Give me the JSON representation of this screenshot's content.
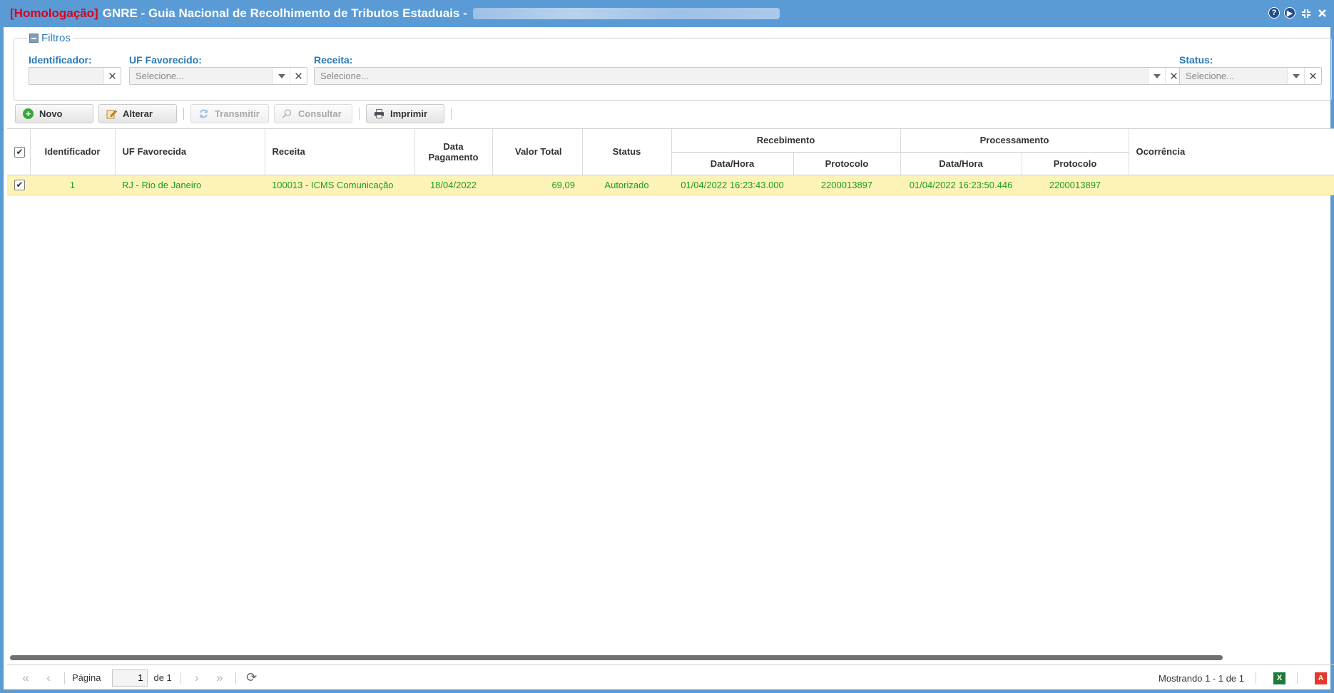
{
  "window": {
    "env_tag": "[Homologação]",
    "title": "GNRE - Guia Nacional de Recolhimento de Tributos Estaduais -",
    "tools": {
      "help_icon": "help-icon",
      "play_icon": "play-icon",
      "collapse_icon": "collapse-icon",
      "close_icon": "close-icon"
    }
  },
  "filters": {
    "legend": "Filtros",
    "identificador": {
      "label": "Identificador:",
      "value": ""
    },
    "uf_favorecido": {
      "label": "UF Favorecido:",
      "placeholder": "Selecione..."
    },
    "receita": {
      "label": "Receita:",
      "placeholder": "Selecione..."
    },
    "status": {
      "label": "Status:",
      "placeholder": "Selecione..."
    }
  },
  "toolbar": {
    "novo": "Novo",
    "alterar": "Alterar",
    "transmitir": "Transmitir",
    "consultar": "Consultar",
    "imprimir": "Imprimir"
  },
  "table": {
    "headers": {
      "identificador": "Identificador",
      "uf_favorecida": "UF Favorecida",
      "receita": "Receita",
      "data_pagamento": "Data Pagamento",
      "valor_total": "Valor Total",
      "status": "Status",
      "recebimento": "Recebimento",
      "processamento": "Processamento",
      "data_hora": "Data/Hora",
      "protocolo": "Protocolo",
      "ocorrencia": "Ocorrência"
    },
    "rows": [
      {
        "identificador": "1",
        "uf_favorecida": "RJ - Rio de Janeiro",
        "receita": "100013 - ICMS Comunicação",
        "data_pagamento": "18/04/2022",
        "valor_total": "69,09",
        "status": "Autorizado",
        "recebimento_data_hora": "01/04/2022 16:23:43.000",
        "recebimento_protocolo": "2200013897",
        "processamento_data_hora": "01/04/2022 16:23:50.446",
        "processamento_protocolo": "2200013897",
        "ocorrencia": ""
      }
    ]
  },
  "pager": {
    "pagina_label": "Página",
    "page": "1",
    "de_label": "de 1",
    "showing": "Mostrando 1 - 1 de 1"
  },
  "colors": {
    "titlebar": "#5b9bd5",
    "env_tag": "#d9001b",
    "label": "#2a7ab8",
    "row_text": "#1a9e1a",
    "row_selected": "#fdf3b8"
  }
}
